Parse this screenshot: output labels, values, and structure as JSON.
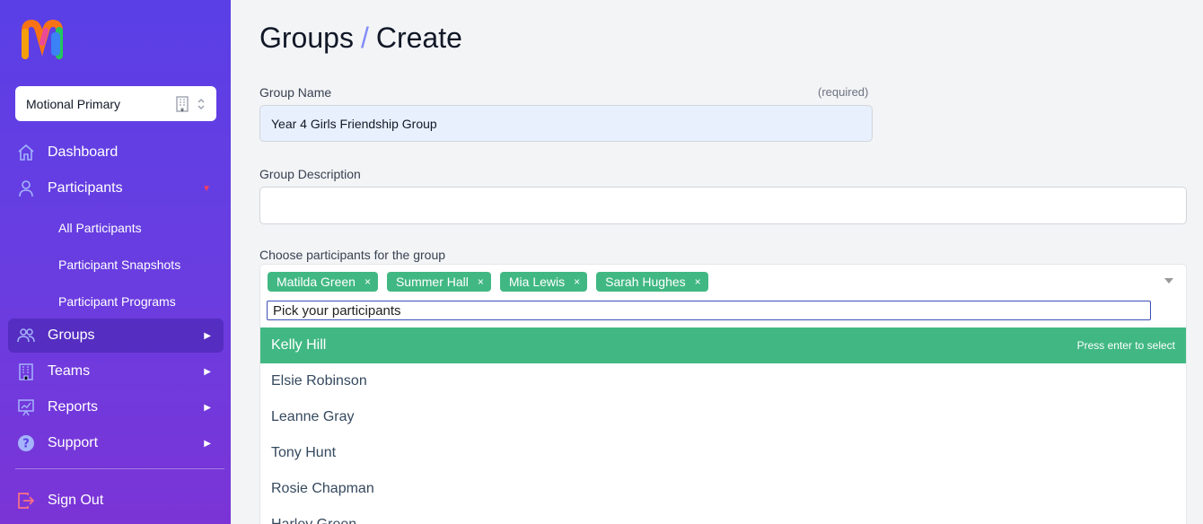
{
  "sidebar": {
    "school_select": {
      "value": "Motional Primary"
    },
    "nav": {
      "dashboard": "Dashboard",
      "participants": "Participants",
      "groups": "Groups",
      "teams": "Teams",
      "reports": "Reports",
      "support": "Support",
      "sign_out": "Sign Out"
    },
    "sub_items": {
      "all_participants": "All Participants",
      "participant_snapshots": "Participant Snapshots",
      "participant_programs": "Participant Programs"
    }
  },
  "header": {
    "breadcrumb_root": "Groups",
    "breadcrumb_sep": "/",
    "breadcrumb_current": "Create"
  },
  "form": {
    "group_name": {
      "label": "Group Name",
      "required_note": "(required)",
      "value": "Year 4 Girls Friendship Group"
    },
    "group_description": {
      "label": "Group Description",
      "value": ""
    },
    "participants": {
      "label": "Choose participants for the group",
      "selected": [
        "Matilda Green",
        "Summer Hall",
        "Mia Lewis",
        "Sarah Hughes"
      ],
      "remove_glyph": "×",
      "search_placeholder": "Pick your participants",
      "highlight_hint": "Press enter to select",
      "options": [
        "Kelly Hill",
        "Elsie Robinson",
        "Leanne Gray",
        "Tony Hunt",
        "Rosie Chapman",
        "Harley Green"
      ]
    }
  },
  "colors": {
    "sidebar_top": "#5a3fe6",
    "sidebar_bottom": "#7b34d6",
    "tag_green": "#41b883",
    "accent_indigo": "#818cf8",
    "participants_arrow": "#f43f5e",
    "sign_out_icon": "#fb7185"
  }
}
